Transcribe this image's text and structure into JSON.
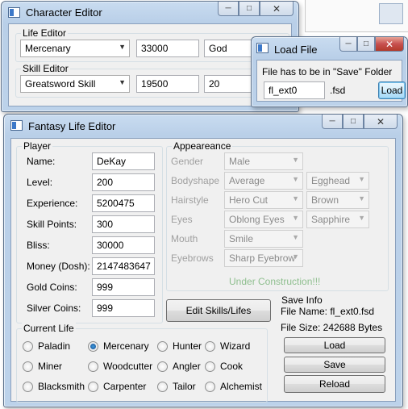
{
  "char_editor": {
    "title": "Character Editor",
    "life_group": "Life Editor",
    "life_combo": "Mercenary",
    "life_value": "33000",
    "life_rank": "God",
    "skill_group": "Skill Editor",
    "skill_combo": "Greatsword Skill",
    "skill_value": "19500",
    "skill_level": "20"
  },
  "load_dialog": {
    "title": "Load File",
    "hint": "File has to be in \"Save\" Folder",
    "filename": "fl_ext0",
    "extension": ".fsd",
    "load_label": "Load"
  },
  "main": {
    "title": "Fantasy Life Editor",
    "player": {
      "group": "Player",
      "fields": [
        {
          "label": "Name:",
          "value": "DeKay"
        },
        {
          "label": "Level:",
          "value": "200"
        },
        {
          "label": "Experience:",
          "value": "5200475"
        },
        {
          "label": "Skill Points:",
          "value": "300"
        },
        {
          "label": "Bliss:",
          "value": "30000"
        },
        {
          "label": "Money (Dosh):",
          "value": "2147483647"
        },
        {
          "label": "Gold Coins:",
          "value": "999"
        },
        {
          "label": "Silver Coins:",
          "value": "999"
        }
      ]
    },
    "appearance": {
      "group": "Appeareance",
      "gender_label": "Gender",
      "gender": "Male",
      "bodyshape_label": "Bodyshape",
      "bodyshape": "Average",
      "bodyshape2": "Egghead",
      "hairstyle_label": "Hairstyle",
      "hairstyle": "Hero Cut",
      "haircolor": "Brown",
      "eyes_label": "Eyes",
      "eyes": "Oblong Eyes",
      "eyecolor": "Sapphire",
      "mouth_label": "Mouth",
      "mouth": "Smile",
      "eyebrows_label": "Eyebrows",
      "eyebrows": "Sharp Eyebrow",
      "construction": "Under Construction!!!"
    },
    "edit_skills_label": "Edit Skills/Lifes",
    "save_info": {
      "group": "Save Info",
      "file_name": "File Name: fl_ext0.fsd",
      "file_size": "File Size: 242688 Bytes",
      "load_label": "Load",
      "save_label": "Save",
      "reload_label": "Reload"
    },
    "current_life": {
      "group": "Current Life",
      "selected": "Mercenary",
      "options": [
        "Paladin",
        "Mercenary",
        "Hunter",
        "Wizard",
        "Miner",
        "Woodcutter",
        "Angler",
        "Cook",
        "Blacksmith",
        "Carpenter",
        "Tailor",
        "Alchemist"
      ]
    }
  },
  "colors": {
    "title_bg": "#b9cfe8",
    "client_bg": "#f0f0f0",
    "close_red": "#c75050",
    "disabled_text": "#a0a0a0",
    "construction_green": "#8fbf8f"
  }
}
